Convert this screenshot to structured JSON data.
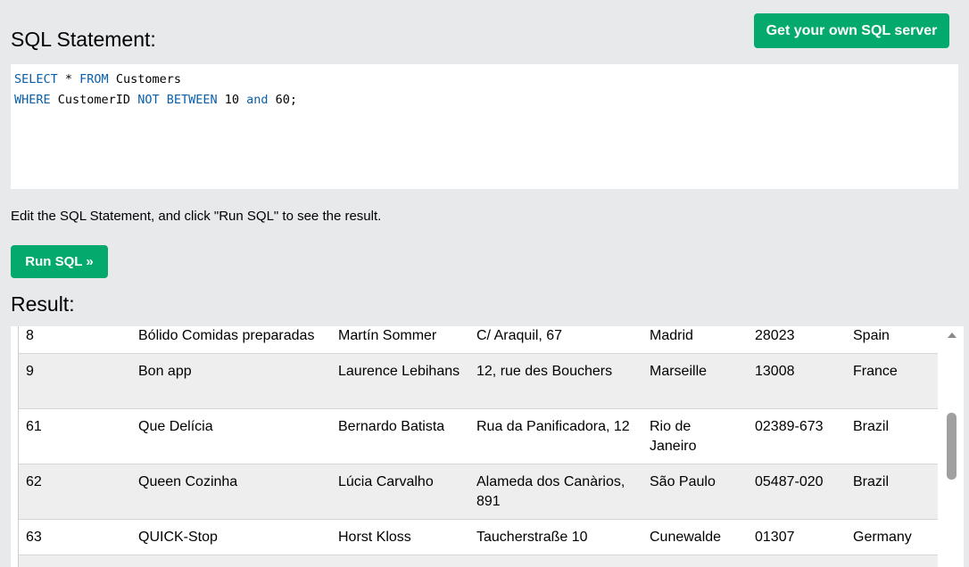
{
  "header": {
    "title": "SQL Statement:",
    "server_button": "Get your own SQL server"
  },
  "editor": {
    "line1": [
      {
        "text": "SELECT",
        "kw": true
      },
      {
        "text": " * ",
        "kw": false
      },
      {
        "text": "FROM",
        "kw": true
      },
      {
        "text": " Customers",
        "kw": false
      }
    ],
    "line2": [
      {
        "text": "WHERE",
        "kw": true
      },
      {
        "text": " CustomerID ",
        "kw": false
      },
      {
        "text": "NOT BETWEEN",
        "kw": true
      },
      {
        "text": " 10 ",
        "kw": false
      },
      {
        "text": "and",
        "kw": true
      },
      {
        "text": " 60;",
        "kw": false
      }
    ]
  },
  "instructions": "Edit the SQL Statement, and click \"Run SQL\" to see the result.",
  "run_button": "Run SQL »",
  "result": {
    "title": "Result:",
    "rows": [
      [
        "8",
        "Bólido Comidas preparadas",
        "Martín Sommer",
        "C/ Araquil, 67",
        "Madrid",
        "28023",
        "Spain"
      ],
      [
        "9",
        "Bon app",
        "Laurence Lebihans",
        "12, rue des Bouchers",
        "Marseille",
        "13008",
        "France"
      ],
      [
        "61",
        "Que Delícia",
        "Bernardo Batista",
        "Rua da Panificadora, 12",
        "Rio de Janeiro",
        "02389-673",
        "Brazil"
      ],
      [
        "62",
        "Queen Cozinha",
        "Lúcia Carvalho",
        "Alameda dos Canàrios, 891",
        "São Paulo",
        "05487-020",
        "Brazil"
      ],
      [
        "63",
        "QUICK-Stop",
        "Horst Kloss",
        "Taucherstraße 10",
        "Cunewalde",
        "01307",
        "Germany"
      ]
    ]
  },
  "colors": {
    "accent": "#04aa6d",
    "keyword": "#0a5fa8",
    "background": "#e7e9eb"
  }
}
